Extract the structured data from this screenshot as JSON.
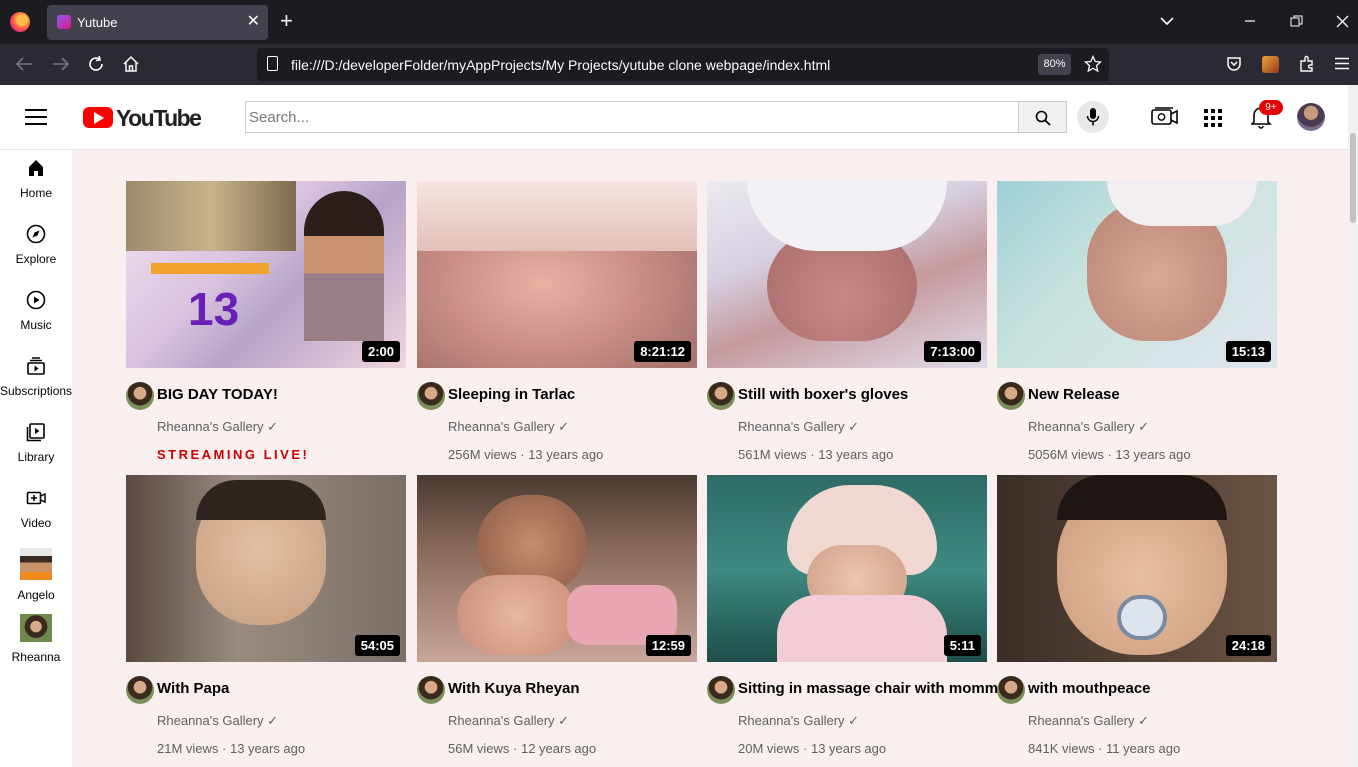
{
  "browser": {
    "tab_title": "Yutube",
    "tab_close": "✕",
    "new_tab": "+",
    "url": "file:///D:/developerFolder/myAppProjects/My Projects/yutube clone webpage/index.html",
    "zoom": "80%"
  },
  "header": {
    "logo_text": "YouTube",
    "search_placeholder": "Search...",
    "notification_count": "9+"
  },
  "sidebar": {
    "items": [
      {
        "label": "Home",
        "icon": "home-icon"
      },
      {
        "label": "Explore",
        "icon": "explore-icon"
      },
      {
        "label": "Music",
        "icon": "music-icon"
      },
      {
        "label": "Subscriptions",
        "icon": "subscriptions-icon"
      },
      {
        "label": "Library",
        "icon": "library-icon"
      },
      {
        "label": "Video",
        "icon": "video-icon"
      }
    ],
    "channels": [
      {
        "label": "Angelo"
      },
      {
        "label": "Rheanna"
      }
    ]
  },
  "videos": [
    {
      "title": "BIG DAY TODAY!",
      "channel": "Rheanna's Gallery ✓",
      "meta": "",
      "live": "STREAMING LIVE!",
      "duration": "2:00",
      "thumb_color": "#e9d7e4"
    },
    {
      "title": "Sleeping in Tarlac",
      "channel": "Rheanna's Gallery ✓",
      "meta": "256M views · 13 years ago",
      "duration": "8:21:12",
      "thumb_color": "#d8a8a0"
    },
    {
      "title": "Still with boxer's gloves",
      "channel": "Rheanna's Gallery ✓",
      "meta": "561M views · 13 years ago",
      "duration": "7:13:00",
      "thumb_color": "#c8b6c8"
    },
    {
      "title": "New Release",
      "channel": "Rheanna's Gallery ✓",
      "meta": "5056M views · 13 years ago",
      "duration": "15:13",
      "thumb_color": "#b9c7c2"
    },
    {
      "title": "With Papa",
      "channel": "Rheanna's Gallery ✓",
      "meta": "21M views · 13 years ago",
      "duration": "54:05",
      "thumb_color": "#8a7a6e"
    },
    {
      "title": "With Kuya Rheyan",
      "channel": "Rheanna's Gallery ✓",
      "meta": "56M views · 12 years ago",
      "duration": "12:59",
      "thumb_color": "#a47b6c"
    },
    {
      "title": "Sitting in massage chair with mommy",
      "channel": "Rheanna's Gallery ✓",
      "meta": "20M views · 13 years ago",
      "duration": "5:11",
      "thumb_color": "#5c8f86"
    },
    {
      "title": "with mouthpeace",
      "channel": "Rheanna's Gallery ✓",
      "meta": "841K views · 11 years ago",
      "duration": "24:18",
      "thumb_color": "#d8b49a"
    }
  ]
}
